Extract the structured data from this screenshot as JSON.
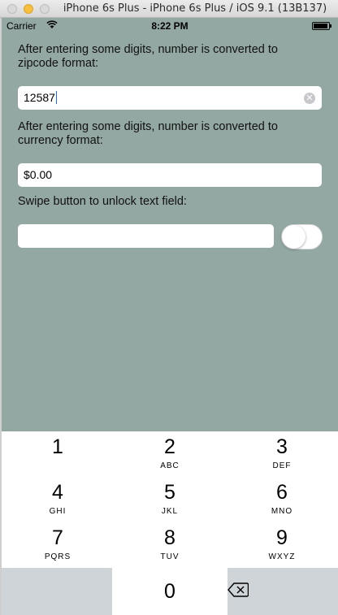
{
  "window": {
    "title": "iPhone 6s Plus - iPhone 6s Plus / iOS 9.1 (13B137)"
  },
  "statusbar": {
    "carrier": "Carrier",
    "time": "8:22 PM",
    "wifi_icon": "wifi-icon",
    "battery_icon": "battery-icon"
  },
  "content": {
    "zip_label": "After entering some digits, number is converted to zipcode format:",
    "zip_value": "12587",
    "currency_label": "After entering some digits, number is converted to currency format:",
    "currency_value": "$0.00",
    "swipe_label": "Swipe button to unlock text field:",
    "locked_value": "",
    "switch_on": false
  },
  "keypad": {
    "keys": [
      {
        "num": "1",
        "letters": ""
      },
      {
        "num": "2",
        "letters": "ABC"
      },
      {
        "num": "3",
        "letters": "DEF"
      },
      {
        "num": "4",
        "letters": "GHI"
      },
      {
        "num": "5",
        "letters": "JKL"
      },
      {
        "num": "6",
        "letters": "MNO"
      },
      {
        "num": "7",
        "letters": "PQRS"
      },
      {
        "num": "8",
        "letters": "TUV"
      },
      {
        "num": "9",
        "letters": "WXYZ"
      },
      {
        "num": "0",
        "letters": ""
      }
    ],
    "delete_icon": "backspace-icon"
  },
  "colors": {
    "background": "#93a7a3",
    "keypad_gray": "#ced4d8",
    "caret": "#1a73e8"
  }
}
